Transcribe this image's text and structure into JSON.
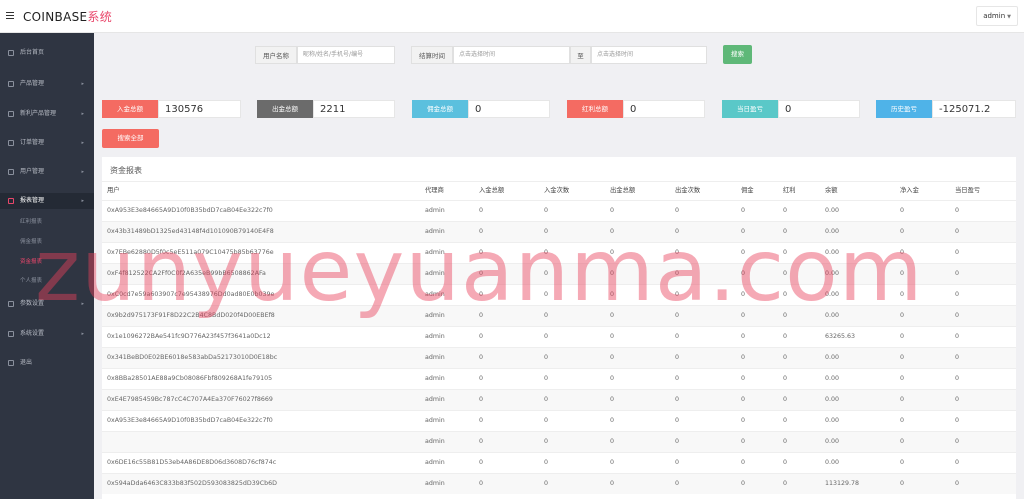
{
  "header": {
    "brand_main": "COINBASE",
    "brand_accent": "系统",
    "user": "admin"
  },
  "sidebar": {
    "items": [
      {
        "label": "后台首页",
        "arrow": ""
      },
      {
        "label": "产品管理",
        "arrow": "▸"
      },
      {
        "label": "新利产品管理",
        "arrow": "▸"
      },
      {
        "label": "订单管理",
        "arrow": "▸"
      },
      {
        "label": "用户管理",
        "arrow": "▸"
      },
      {
        "label": "报表管理",
        "arrow": "▸"
      },
      {
        "label": "参数设置",
        "arrow": "▸"
      },
      {
        "label": "系统设置",
        "arrow": "▸"
      },
      {
        "label": "退出",
        "arrow": ""
      }
    ],
    "sub_items": [
      {
        "label": "红利报表"
      },
      {
        "label": "佣金报表"
      },
      {
        "label": "资金报表"
      },
      {
        "label": "个人报表"
      }
    ]
  },
  "search": {
    "user_label": "用户名称",
    "user_placeholder": "昵称/姓名/手机号/编号",
    "time_label": "结算时间",
    "start_placeholder": "点击选择时间",
    "to_label": "至",
    "end_placeholder": "点击选择时间",
    "search_button": "搜索",
    "search_all_button": "搜索全部"
  },
  "stats": [
    {
      "label": "入金总额",
      "value": "130576",
      "color": "#f46b62"
    },
    {
      "label": "出金总额",
      "value": "2211",
      "color": "#6b6b6b"
    },
    {
      "label": "佣金总额",
      "value": "0",
      "color": "#5bc0de"
    },
    {
      "label": "红利总额",
      "value": "0",
      "color": "#f46b62"
    },
    {
      "label": "当日盈亏",
      "value": "0",
      "color": "#5ac8c8"
    },
    {
      "label": "历史盈亏",
      "value": "-125071.2",
      "color": "#4fb3e8"
    }
  ],
  "panel": {
    "title": "资金报表"
  },
  "table": {
    "columns": [
      "用户",
      "代理商",
      "入金总额",
      "入金次数",
      "出金总额",
      "出金次数",
      "佣金",
      "红利",
      "余额",
      "净入金",
      "当日盈亏"
    ],
    "rows": [
      [
        "0xA953E3e84665A9D10f0B35bdD7caB04Ee322c7f0",
        "admin",
        "0",
        "0",
        "0",
        "0",
        "0",
        "0",
        "0.00",
        "0",
        "0"
      ],
      [
        "0x43b31489bD1325ed43148f4d101090B79140E4F8",
        "admin",
        "0",
        "0",
        "0",
        "0",
        "0",
        "0",
        "0.00",
        "0",
        "0"
      ],
      [
        "0x7EBe62880D5f0c5eE511a079C10475b85b63776e",
        "admin",
        "0",
        "0",
        "0",
        "0",
        "0",
        "0",
        "0.00",
        "0",
        "0"
      ],
      [
        "0xF4f812522CA2Ff0C0f2A635eB99bB6508862AFa",
        "admin",
        "0",
        "0",
        "0",
        "0",
        "0",
        "0",
        "0.00",
        "0",
        "0"
      ],
      [
        "0xC0cd7e59a603907c7e95438976Dd0ad80E0b039e",
        "admin",
        "0",
        "0",
        "0",
        "0",
        "0",
        "0",
        "0.00",
        "0",
        "0"
      ],
      [
        "0x9b2d975173F91F8D22C2B4C8BdD020f4D00EBEf8",
        "admin",
        "0",
        "0",
        "0",
        "0",
        "0",
        "0",
        "0.00",
        "0",
        "0"
      ],
      [
        "0x1e1096272BAe541fc9D776A23f457f3641a0Dc12",
        "admin",
        "0",
        "0",
        "0",
        "0",
        "0",
        "0",
        "63265.63",
        "0",
        "0"
      ],
      [
        "0x341BeBD0E02BE6018e583abDa52173010D0E18bc",
        "admin",
        "0",
        "0",
        "0",
        "0",
        "0",
        "0",
        "0.00",
        "0",
        "0"
      ],
      [
        "0x8BBa28501AE88a9Cb08086Fbf809268A1fe79105",
        "admin",
        "0",
        "0",
        "0",
        "0",
        "0",
        "0",
        "0.00",
        "0",
        "0"
      ],
      [
        "0xE4E7985459Bc787cC4C707A4Ea370F76027f8669",
        "admin",
        "0",
        "0",
        "0",
        "0",
        "0",
        "0",
        "0.00",
        "0",
        "0"
      ],
      [
        "0xA953E3e84665A9D10f0B35bdD7caB04Ee322c7f0",
        "admin",
        "0",
        "0",
        "0",
        "0",
        "0",
        "0",
        "0.00",
        "0",
        "0"
      ],
      [
        "",
        "admin",
        "0",
        "0",
        "0",
        "0",
        "0",
        "0",
        "0.00",
        "0",
        "0"
      ],
      [
        "0x6DE16c55B81D53eb4A86DE8D06d3608D76cf874c",
        "admin",
        "0",
        "0",
        "0",
        "0",
        "0",
        "0",
        "0.00",
        "0",
        "0"
      ],
      [
        "0x594aDda6463C833b83f502D593083825dD39Cb6D",
        "admin",
        "0",
        "0",
        "0",
        "0",
        "0",
        "0",
        "113129.78",
        "0",
        "0"
      ]
    ]
  },
  "watermark": "zunyueyuanma.com"
}
